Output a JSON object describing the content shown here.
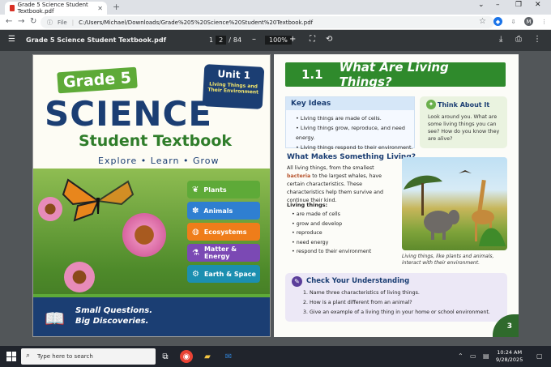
{
  "browser": {
    "tab_title": "Grade 5 Science Student Textbook.pdf",
    "new_tab": "+",
    "window_controls": [
      "⌄",
      "–",
      "❐",
      "✕"
    ],
    "url_prefix": "File",
    "url": "C:/Users/Michael/Downloads/Grade%205%20Science%20Student%20Textbook.pdf",
    "profile_initial": "M"
  },
  "pdf_toolbar": {
    "file_name": "Grade 5 Science Student Textbook.pdf",
    "page_current": "1",
    "page_display": "2",
    "page_total": "84",
    "zoom": "100%",
    "zoom_out": "–",
    "zoom_in": "+"
  },
  "cover": {
    "grade": "Grade 5",
    "unit_label": "Unit 1",
    "unit_title": "Living Things and Their Environment",
    "title": "SCIENCE",
    "subtitle": "Student Textbook",
    "tagline": "Explore • Learn • Grow",
    "topics": [
      {
        "label": "Plants",
        "color": "#5eaa38",
        "icon": "leaf-icon"
      },
      {
        "label": "Animals",
        "color": "#2f7fd1",
        "icon": "paw-icon"
      },
      {
        "label": "Ecosystems",
        "color": "#ef7d1a",
        "icon": "globe-icon"
      },
      {
        "label": "Matter & Energy",
        "color": "#7b49b4",
        "icon": "flask-icon"
      },
      {
        "label": "Earth & Space",
        "color": "#1c8fb0",
        "icon": "gear-icon"
      }
    ],
    "footer_line1": "Small Questions.",
    "footer_line2": "Big Discoveries."
  },
  "lesson": {
    "section_number": "1.1",
    "section_title": "What Are Living Things?",
    "key_ideas_title": "Key Ideas",
    "key_ideas": [
      "Living things are made of cells.",
      "Living things grow, reproduce, and need energy.",
      "Living things respond to their environment."
    ],
    "think_title": "Think About It",
    "think_text": "Look around you. What are some living things you can see? How do you know they are alive?",
    "makes_living_title": "What Makes Something Living?",
    "para_pre": "All living things, from the smallest ",
    "para_bold": "bacteria",
    "para_post": " to the largest whales, have certain characteristics. These characteristics help them survive and continue their kind.",
    "list_title": "Living things:",
    "list_items": [
      "are made of cells",
      "grow and develop",
      "reproduce",
      "need energy",
      "respond to their environment"
    ],
    "photo_caption": "Living things, like plants and animals, interact with their environment.",
    "check_title": "Check Your Understanding",
    "check_items": [
      "1.   Name three characteristics of living things.",
      "2.   How is a plant different from an animal?",
      "3.   Give an example of a living thing in your home or school environment."
    ],
    "page_number": "3"
  },
  "taskbar": {
    "search_placeholder": "Type here to search",
    "time": "10:24 AM",
    "date": "9/28/2025"
  }
}
